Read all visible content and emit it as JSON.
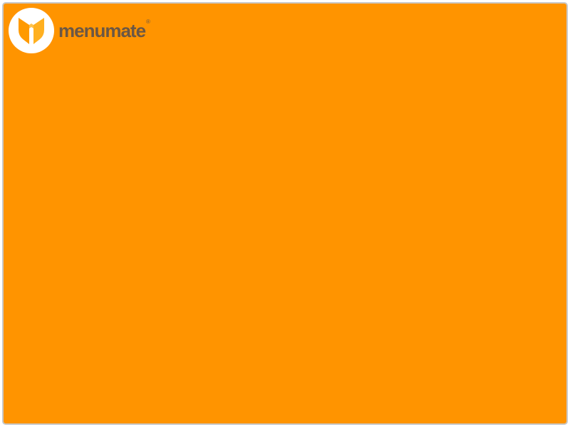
{
  "app": {
    "brand_name": "menumate",
    "registered_mark": "®",
    "logo_icon": "menumate-y-shield-logo",
    "background_color": "#ff9400",
    "wordmark_color": "#6b5744",
    "logo_circle_color": "#ffffff",
    "logo_shield_color": "#ff9a00"
  }
}
